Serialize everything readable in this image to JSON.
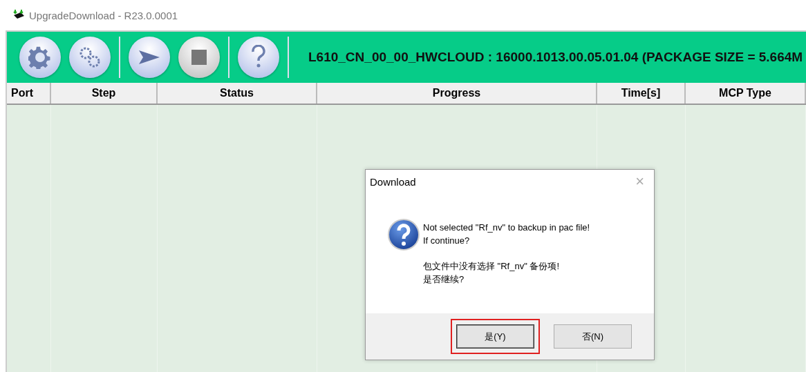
{
  "window": {
    "title": "UpgradeDownload - R23.0.0001"
  },
  "toolbar": {
    "groups": [
      {
        "buttons": [
          {
            "kind": "settings"
          },
          {
            "kind": "gears"
          }
        ]
      },
      {
        "buttons": [
          {
            "kind": "start"
          },
          {
            "kind": "stop"
          }
        ]
      },
      {
        "buttons": [
          {
            "kind": "help"
          }
        ]
      }
    ],
    "package_info": "L610_CN_00_00_HWCLOUD : 16000.1013.00.05.01.04 (PACKAGE SIZE = 5.664M"
  },
  "table": {
    "columns": [
      "Port",
      "Step",
      "Status",
      "Progress",
      "Time[s]",
      "MCP Type"
    ]
  },
  "dialog": {
    "title": "Download",
    "close": "×",
    "message_en": [
      "Not selected \"Rf_nv\" to backup in pac file!",
      "If continue?"
    ],
    "message_zh": [
      "包文件中没有选择 \"Rf_nv\" 备份项!",
      "是否继续?"
    ],
    "buttons": [
      {
        "label": "是(Y)",
        "highlighted": true
      },
      {
        "label": "否(N)",
        "highlighted": false
      }
    ]
  }
}
